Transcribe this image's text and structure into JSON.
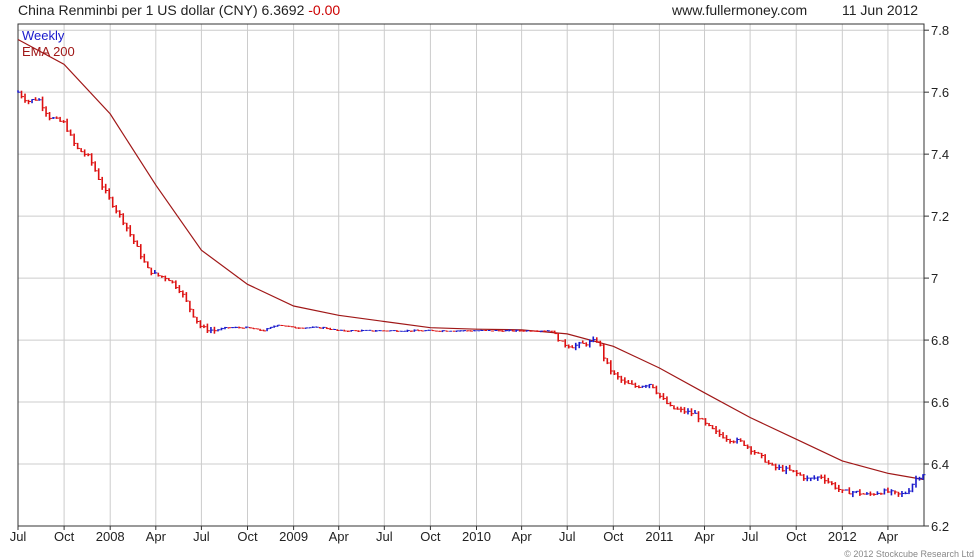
{
  "header": {
    "title": "China Renminbi per 1 US dollar (CNY) 6.3692",
    "change": "-0.00",
    "site": "www.fullermoney.com",
    "date": "11 Jun 2012"
  },
  "copyright": "© 2012 Stockcube Research Ltd",
  "colors": {
    "up": "#1a1acc",
    "down": "#dd1111",
    "ema": "#a01818",
    "grid": "#cccccc",
    "axis": "#333333"
  },
  "chart_data": {
    "type": "line",
    "legend": [
      "Weekly",
      "EMA 200"
    ],
    "legend_placement": "top-left",
    "ylim": [
      6.2,
      7.82
    ],
    "yticks": [
      6.2,
      6.4,
      6.6,
      6.8,
      7.0,
      7.2,
      7.4,
      7.6,
      7.8
    ],
    "ytick_labels": [
      "6.2",
      "6.4",
      "6.6",
      "6.8",
      "7",
      "7.2",
      "7.4",
      "7.6",
      "7.8"
    ],
    "xlim": [
      "2007-07-01",
      "2012-06-12"
    ],
    "xticks": [
      {
        "date": "2007-07-01",
        "label": "Jul"
      },
      {
        "date": "2007-10-01",
        "label": "Oct"
      },
      {
        "date": "2008-01-01",
        "label": "2008"
      },
      {
        "date": "2008-04-01",
        "label": "Apr"
      },
      {
        "date": "2008-07-01",
        "label": "Jul"
      },
      {
        "date": "2008-10-01",
        "label": "Oct"
      },
      {
        "date": "2009-01-01",
        "label": "2009"
      },
      {
        "date": "2009-04-01",
        "label": "Apr"
      },
      {
        "date": "2009-07-01",
        "label": "Jul"
      },
      {
        "date": "2009-10-01",
        "label": "Oct"
      },
      {
        "date": "2010-01-01",
        "label": "2010"
      },
      {
        "date": "2010-04-01",
        "label": "Apr"
      },
      {
        "date": "2010-07-01",
        "label": "Jul"
      },
      {
        "date": "2010-10-01",
        "label": "Oct"
      },
      {
        "date": "2011-01-01",
        "label": "2011"
      },
      {
        "date": "2011-04-01",
        "label": "Apr"
      },
      {
        "date": "2011-07-01",
        "label": "Jul"
      },
      {
        "date": "2011-10-01",
        "label": "Oct"
      },
      {
        "date": "2012-01-01",
        "label": "2012"
      },
      {
        "date": "2012-04-01",
        "label": "Apr"
      }
    ],
    "grid": true,
    "series": [
      {
        "name": "Weekly",
        "points": [
          [
            "2007-07-01",
            7.6
          ],
          [
            "2007-07-20",
            7.57
          ],
          [
            "2007-08-10",
            7.58
          ],
          [
            "2007-09-01",
            7.52
          ],
          [
            "2007-10-01",
            7.5
          ],
          [
            "2007-10-25",
            7.42
          ],
          [
            "2007-11-20",
            7.39
          ],
          [
            "2007-12-15",
            7.3
          ],
          [
            "2008-01-01",
            7.25
          ],
          [
            "2008-01-25",
            7.19
          ],
          [
            "2008-02-20",
            7.11
          ],
          [
            "2008-03-15",
            7.03
          ],
          [
            "2008-04-01",
            7.01
          ],
          [
            "2008-04-25",
            7.0
          ],
          [
            "2008-05-20",
            6.96
          ],
          [
            "2008-06-15",
            6.88
          ],
          [
            "2008-07-01",
            6.84
          ],
          [
            "2008-07-25",
            6.83
          ],
          [
            "2008-08-20",
            6.84
          ],
          [
            "2008-09-15",
            6.84
          ],
          [
            "2008-10-01",
            6.84
          ],
          [
            "2008-11-01",
            6.83
          ],
          [
            "2008-12-01",
            6.85
          ],
          [
            "2009-01-01",
            6.84
          ],
          [
            "2009-02-01",
            6.84
          ],
          [
            "2009-03-01",
            6.84
          ],
          [
            "2009-04-01",
            6.83
          ],
          [
            "2009-06-01",
            6.83
          ],
          [
            "2009-07-01",
            6.83
          ],
          [
            "2009-10-01",
            6.83
          ],
          [
            "2010-01-01",
            6.83
          ],
          [
            "2010-04-01",
            6.83
          ],
          [
            "2010-06-01",
            6.83
          ],
          [
            "2010-06-20",
            6.79
          ],
          [
            "2010-07-10",
            6.78
          ],
          [
            "2010-08-10",
            6.79
          ],
          [
            "2010-09-01",
            6.8
          ],
          [
            "2010-09-15",
            6.73
          ],
          [
            "2010-10-01",
            6.69
          ],
          [
            "2010-10-25",
            6.66
          ],
          [
            "2010-11-15",
            6.65
          ],
          [
            "2010-12-15",
            6.66
          ],
          [
            "2011-01-01",
            6.62
          ],
          [
            "2011-01-25",
            6.58
          ],
          [
            "2011-02-20",
            6.57
          ],
          [
            "2011-03-15",
            6.56
          ],
          [
            "2011-04-01",
            6.53
          ],
          [
            "2011-04-25",
            6.5
          ],
          [
            "2011-05-20",
            6.48
          ],
          [
            "2011-06-15",
            6.47
          ],
          [
            "2011-07-01",
            6.45
          ],
          [
            "2011-07-25",
            6.42
          ],
          [
            "2011-08-15",
            6.39
          ],
          [
            "2011-09-15",
            6.38
          ],
          [
            "2011-10-01",
            6.37
          ],
          [
            "2011-10-25",
            6.35
          ],
          [
            "2011-11-20",
            6.36
          ],
          [
            "2011-12-15",
            6.33
          ],
          [
            "2012-01-01",
            6.31
          ],
          [
            "2012-01-25",
            6.31
          ],
          [
            "2012-02-20",
            6.3
          ],
          [
            "2012-03-15",
            6.31
          ],
          [
            "2012-04-01",
            6.31
          ],
          [
            "2012-04-25",
            6.3
          ],
          [
            "2012-05-10",
            6.31
          ],
          [
            "2012-05-25",
            6.35
          ],
          [
            "2012-06-11",
            6.37
          ]
        ]
      },
      {
        "name": "EMA 200",
        "points": [
          [
            "2007-07-01",
            7.77
          ],
          [
            "2007-10-01",
            7.69
          ],
          [
            "2008-01-01",
            7.53
          ],
          [
            "2008-04-01",
            7.3
          ],
          [
            "2008-07-01",
            7.09
          ],
          [
            "2008-10-01",
            6.98
          ],
          [
            "2009-01-01",
            6.91
          ],
          [
            "2009-04-01",
            6.88
          ],
          [
            "2009-07-01",
            6.86
          ],
          [
            "2009-10-01",
            6.84
          ],
          [
            "2010-01-01",
            6.835
          ],
          [
            "2010-04-01",
            6.833
          ],
          [
            "2010-07-01",
            6.82
          ],
          [
            "2010-10-01",
            6.78
          ],
          [
            "2011-01-01",
            6.71
          ],
          [
            "2011-04-01",
            6.63
          ],
          [
            "2011-07-01",
            6.55
          ],
          [
            "2011-10-01",
            6.48
          ],
          [
            "2012-01-01",
            6.41
          ],
          [
            "2012-04-01",
            6.37
          ],
          [
            "2012-06-11",
            6.35
          ]
        ]
      }
    ]
  }
}
